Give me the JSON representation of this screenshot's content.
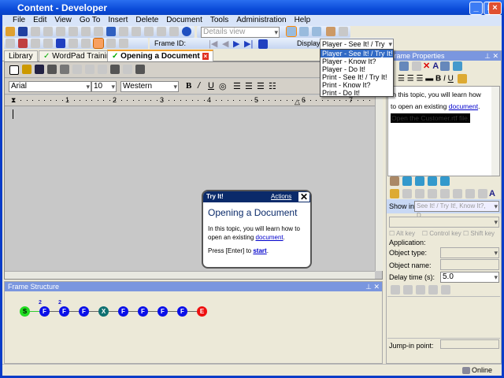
{
  "window": {
    "title": "Content - Developer"
  },
  "menu": [
    "File",
    "Edit",
    "View",
    "Go To",
    "Insert",
    "Delete",
    "Document",
    "Tools",
    "Administration",
    "Help"
  ],
  "toolbar": {
    "view_select": "Details view",
    "frame_id_label": "Frame ID:",
    "display_label": "Display:",
    "display_value": "Player - See It! / Try It!"
  },
  "display_options": [
    "Player - See It! / Try It!",
    "Player - Know It?",
    "Player - Do It!",
    "Print - See It! / Try It!",
    "Print - Know It?",
    "Print - Do It!"
  ],
  "tabs": [
    {
      "label": "Library"
    },
    {
      "label": "WordPad Training"
    },
    {
      "label": "Opening a Document"
    }
  ],
  "editor": {
    "font": "Arial",
    "size": "10",
    "script": "Western",
    "ruler": [
      "1",
      "2",
      "3",
      "4",
      "5",
      "6",
      "7"
    ]
  },
  "bubble": {
    "header": "Try It!",
    "actions": "Actions",
    "title": "Opening a Document",
    "body": "In this topic, you will learn how to open an existing ",
    "link": "document",
    "period": ".",
    "press": "Press [Enter] to ",
    "start": "start",
    "dot": "."
  },
  "frame_props": {
    "title": "Frame Properties",
    "text1": "In this topic, you will learn how to open an existing ",
    "link": "document",
    "period": ".",
    "highlight": "Open the Customer.rtf file.",
    "show_in_label": "Show in:",
    "show_in_value": "See It! / Try It!, Know It?, D...",
    "alt": "Alt key",
    "ctrl": "Control key",
    "shift": "Shift key",
    "application": "Application:",
    "object_type": "Object type:",
    "object_name": "Object name:",
    "delay_label": "Delay time (s):",
    "delay_value": "5.0",
    "jump_in": "Jump-in point:"
  },
  "frame_structure": {
    "title": "Frame Structure",
    "nodes": [
      {
        "t": "S",
        "c": "#22dd22",
        "fg": "#000",
        "badge": ""
      },
      {
        "t": "F",
        "c": "#0a10e8",
        "badge": "2"
      },
      {
        "t": "F",
        "c": "#0a10e8",
        "badge": "2"
      },
      {
        "t": "F",
        "c": "#0a10e8",
        "badge": ""
      },
      {
        "t": "X",
        "c": "#0e7070",
        "badge": ""
      },
      {
        "t": "F",
        "c": "#0a10e8",
        "badge": ""
      },
      {
        "t": "F",
        "c": "#0a10e8",
        "badge": ""
      },
      {
        "t": "F",
        "c": "#0a10e8",
        "badge": ""
      },
      {
        "t": "F",
        "c": "#0a10e8",
        "badge": ""
      },
      {
        "t": "E",
        "c": "#ee1010",
        "badge": ""
      }
    ]
  },
  "status": {
    "online": "Online"
  }
}
